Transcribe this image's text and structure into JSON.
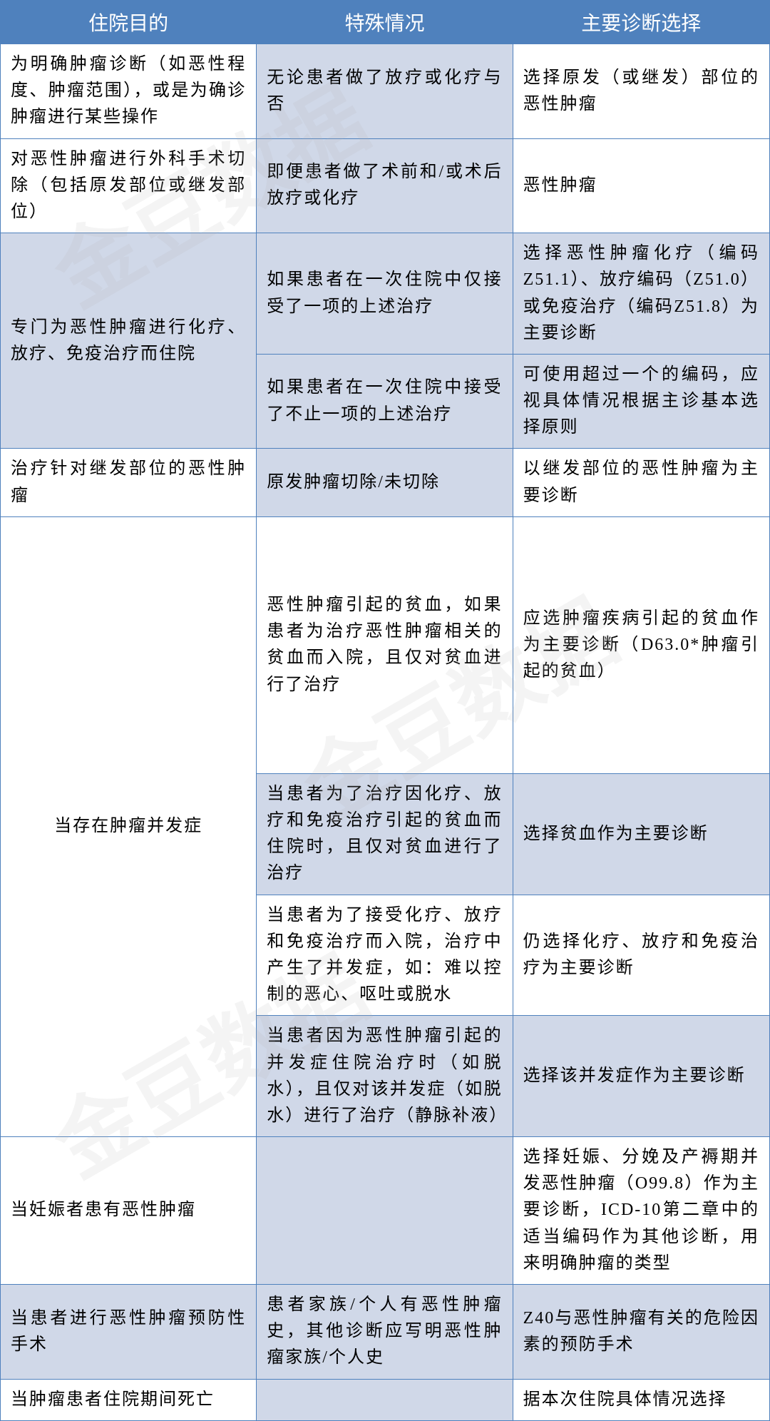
{
  "watermark": "金豆数据",
  "headers": {
    "col1": "住院目的",
    "col2": "特殊情况",
    "col3": "主要诊断选择"
  },
  "rows": {
    "r1": {
      "purpose": "为明确肿瘤诊断（如恶性程度、肿瘤范围），或是为确诊肿瘤进行某些操作",
      "special": "无论患者做了放疗或化疗与否",
      "diagnosis": "选择原发（或继发）部位的恶性肿瘤"
    },
    "r2": {
      "purpose": "对恶性肿瘤进行外科手术切除（包括原发部位或继发部位）",
      "special": "即便患者做了术前和/或术后放疗或化疗",
      "diagnosis": "恶性肿瘤"
    },
    "r3": {
      "purpose": "专门为恶性肿瘤进行化疗、放疗、免疫治疗而住院",
      "special_a": "如果患者在一次住院中仅接受了一项的上述治疗",
      "diagnosis_a": "选择恶性肿瘤化疗（编码Z51.1）、放疗编码（Z51.0）或免疫治疗（编码Z51.8）为主要诊断",
      "special_b": "如果患者在一次住院中接受了不止一项的上述治疗",
      "diagnosis_b": "可使用超过一个的编码，应视具体情况根据主诊基本选择原则"
    },
    "r4": {
      "purpose": "治疗针对继发部位的恶性肿瘤",
      "special": "原发肿瘤切除/未切除",
      "diagnosis": "以继发部位的恶性肿瘤为主要诊断"
    },
    "r5": {
      "purpose": "当存在肿瘤并发症",
      "special_a": "恶性肿瘤引起的贫血，如果患者为治疗恶性肿瘤相关的贫血而入院，且仅对贫血进行了治疗",
      "diagnosis_a": "应选肿瘤疾病引起的贫血作为主要诊断（D63.0*肿瘤引起的贫血）",
      "special_b": "当患者为了治疗因化疗、放疗和免疫治疗引起的贫血而住院时，且仅对贫血进行了治疗",
      "diagnosis_b": "选择贫血作为主要诊断",
      "special_c": "当患者为了接受化疗、放疗和免疫治疗而入院，治疗中产生了并发症，如：难以控制的恶心、呕吐或脱水",
      "diagnosis_c": "仍选择化疗、放疗和免疫治疗为主要诊断",
      "special_d": "当患者因为恶性肿瘤引起的并发症住院治疗时（如脱水），且仅对该并发症（如脱水）进行了治疗（静脉补液）",
      "diagnosis_d": "选择该并发症作为主要诊断"
    },
    "r6": {
      "purpose": "当妊娠者患有恶性肿瘤",
      "special": "",
      "diagnosis": "选择妊娠、分娩及产褥期并发恶性肿瘤（O99.8）作为主要诊断，ICD-10第二章中的适当编码作为其他诊断，用来明确肿瘤的类型"
    },
    "r7": {
      "purpose": "当患者进行恶性肿瘤预防性手术",
      "special": "患者家族/个人有恶性肿瘤史，其他诊断应写明恶性肿瘤家族/个人史",
      "diagnosis": "Z40与恶性肿瘤有关的危险因素的预防手术"
    },
    "r8": {
      "purpose": "当肿瘤患者住院期间死亡",
      "special": "",
      "diagnosis": "据本次住院具体情况选择"
    }
  }
}
